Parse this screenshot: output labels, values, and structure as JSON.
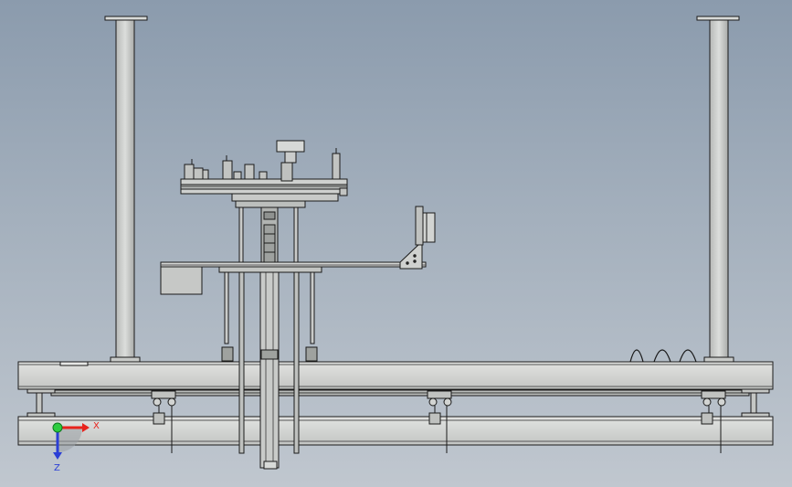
{
  "triad": {
    "x_label": "X",
    "z_label": "Z",
    "x_color": "#e8231c",
    "z_color": "#2b3fd6",
    "origin_color": "#2ecc40"
  },
  "colors": {
    "background_top": "#8b9bad",
    "background_bottom": "#c0c7cf",
    "metal_light": "#d2d4d2",
    "metal_mid": "#b5b8b6",
    "outline": "#1a1a1a"
  }
}
